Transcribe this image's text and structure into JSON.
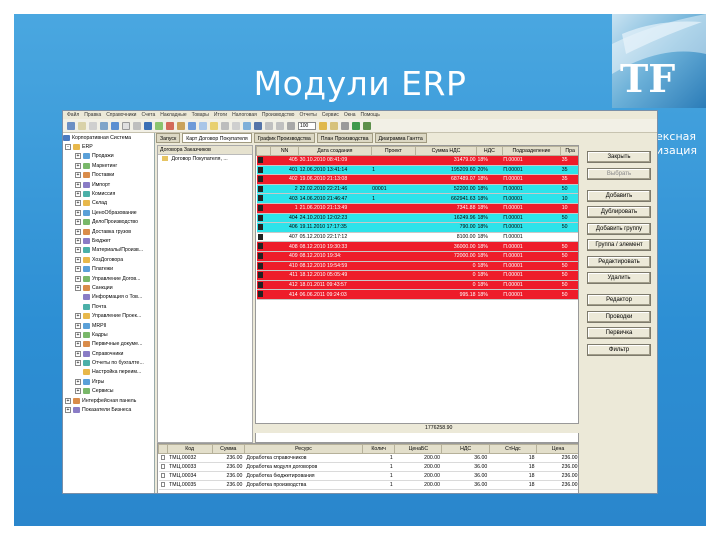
{
  "slide": {
    "title": "Модули ERP",
    "logo_text": "TF",
    "corner_caption_line1": "ексная",
    "corner_caption_line2": "изация"
  },
  "app": {
    "menu": [
      "Файл",
      "Правка",
      "Справочники",
      "Счета",
      "Накладные",
      "Товары",
      "Итоги",
      "Налоговая",
      "Производство",
      "Отчеты",
      "Сервис",
      "Окна",
      "Помощь"
    ],
    "zoom_value": "100",
    "sidebar": {
      "root": "Корпоративная Система",
      "items": [
        {
          "label": "ERP",
          "level": 0,
          "expand": "-"
        },
        {
          "label": "Продажи",
          "level": 1,
          "expand": "+"
        },
        {
          "label": "Маркетинг",
          "level": 1,
          "expand": "+"
        },
        {
          "label": "Поставки",
          "level": 1,
          "expand": "+"
        },
        {
          "label": "Импорт",
          "level": 1,
          "expand": "+"
        },
        {
          "label": "Комиссия",
          "level": 1,
          "expand": "+"
        },
        {
          "label": "Склад",
          "level": 1,
          "expand": "+"
        },
        {
          "label": "ЦеноОбразование",
          "level": 1,
          "expand": "+"
        },
        {
          "label": "ДелоПроизводство",
          "level": 1,
          "expand": "+"
        },
        {
          "label": "Доставка грузов",
          "level": 1,
          "expand": "+"
        },
        {
          "label": "Бюджет",
          "level": 1,
          "expand": "+"
        },
        {
          "label": "Материалы/Произв...",
          "level": 1,
          "expand": "+"
        },
        {
          "label": "ХозДоговора",
          "level": 1,
          "expand": "+"
        },
        {
          "label": "Платежи",
          "level": 1,
          "expand": "+"
        },
        {
          "label": "Управление Догов...",
          "level": 1,
          "expand": "+"
        },
        {
          "label": "Санкции",
          "level": 1,
          "expand": "+"
        },
        {
          "label": "Информация о Тов...",
          "level": 1,
          "expand": ""
        },
        {
          "label": "Почта",
          "level": 1,
          "expand": ""
        },
        {
          "label": "Управление Проек...",
          "level": 1,
          "expand": "+"
        },
        {
          "label": "MRPII",
          "level": 1,
          "expand": "+"
        },
        {
          "label": "Кадры",
          "level": 1,
          "expand": "+"
        },
        {
          "label": "Первичные докуме...",
          "level": 1,
          "expand": "+"
        },
        {
          "label": "Справочники",
          "level": 1,
          "expand": "+"
        },
        {
          "label": "Отчеты по бухгалте...",
          "level": 1,
          "expand": "+"
        },
        {
          "label": "Настройка переим...",
          "level": 1,
          "expand": ""
        },
        {
          "label": "Игры",
          "level": 1,
          "expand": "+"
        },
        {
          "label": "Сервисы",
          "level": 1,
          "expand": "+"
        },
        {
          "label": "Интерфейсная панель",
          "level": 0,
          "expand": "+"
        },
        {
          "label": "Показатели Бизнеса",
          "level": 0,
          "expand": "+"
        }
      ]
    },
    "tabs": [
      {
        "label": "Запуск",
        "active": false
      },
      {
        "label": "Карт Договор Покупателя",
        "active": true
      },
      {
        "label": "График Производства",
        "active": false
      },
      {
        "label": "План Производства",
        "active": false
      },
      {
        "label": "Диаграмма Гантта",
        "active": false
      }
    ],
    "subtree": {
      "header": "Договора Заказчиков",
      "row": "Договор Покупателя, ..."
    },
    "grid": {
      "columns": [
        "",
        "NN",
        "Дата создания",
        "Проект",
        "Сумма НДС",
        "НДС",
        "Подразделение",
        "Пра"
      ],
      "rows": [
        {
          "nn": "405",
          "date": "30.10.2010 08:41:09",
          "project": "",
          "sum": "31479.00",
          "vat": "18%",
          "dept": "П.00001",
          "pr": "35",
          "color": "red"
        },
        {
          "nn": "401",
          "date": "12.06.2010 13:41:14",
          "project": "1",
          "sum": "195209.60",
          "vat": "20%",
          "dept": "П.00001",
          "pr": "35",
          "color": "cyan"
        },
        {
          "nn": "402",
          "date": "19.06.2010 21:13:08",
          "project": "",
          "sum": "687489.07",
          "vat": "18%",
          "dept": "П.00001",
          "pr": "35",
          "color": "red"
        },
        {
          "nn": "2",
          "date": "22.02.2010 22:21:46",
          "project": "00001",
          "sum": "52200.00",
          "vat": "18%",
          "dept": "П.00001",
          "pr": "50",
          "color": "cyan"
        },
        {
          "nn": "403",
          "date": "14.06.2010 21:46:47",
          "project": "1",
          "sum": "662941.63",
          "vat": "18%",
          "dept": "П.00001",
          "pr": "10",
          "color": "cyan"
        },
        {
          "nn": "1",
          "date": "21.06.2010 21:13:49",
          "project": "",
          "sum": "7341.88",
          "vat": "18%",
          "dept": "П.00001",
          "pr": "10",
          "color": "red"
        },
        {
          "nn": "404",
          "date": "24.10.2010 12:02:23",
          "project": "",
          "sum": "16249.96",
          "vat": "18%",
          "dept": "П.00001",
          "pr": "50",
          "color": "cyan"
        },
        {
          "nn": "406",
          "date": "19.11.2010 17:17:35",
          "project": "",
          "sum": "790.00",
          "vat": "18%",
          "dept": "П.00001",
          "pr": "50",
          "color": "cyan"
        },
        {
          "nn": "407",
          "date": "05.12.2010 22:17:12",
          "project": "",
          "sum": "8100.00",
          "vat": "18%",
          "dept": "П.00001",
          "pr": "",
          "color": "white"
        },
        {
          "nn": "408",
          "date": "08.12.2010 19:30:33",
          "project": "",
          "sum": "36000.00",
          "vat": "18%",
          "dept": "П.00001",
          "pr": "50",
          "color": "red"
        },
        {
          "nn": "409",
          "date": "08.12.2010 19:34:",
          "project": "",
          "sum": "72000.00",
          "vat": "18%",
          "dept": "П.00001",
          "pr": "50",
          "color": "red"
        },
        {
          "nn": "410",
          "date": "08.12.2010 19:54:59",
          "project": "",
          "sum": "0",
          "vat": "18%",
          "dept": "П.00001",
          "pr": "50",
          "color": "red"
        },
        {
          "nn": "411",
          "date": "18.12.2010 05:05:49",
          "project": "",
          "sum": "0",
          "vat": "18%",
          "dept": "П.00001",
          "pr": "50",
          "color": "red"
        },
        {
          "nn": "412",
          "date": "18.01.2011 09:43:57",
          "project": "",
          "sum": "0",
          "vat": "18%",
          "dept": "П.00001",
          "pr": "50",
          "color": "red"
        },
        {
          "nn": "414",
          "date": "06.06.2011 09:24:03",
          "project": "",
          "sum": "995.18",
          "vat": "18%",
          "dept": "П.00001",
          "pr": "50",
          "color": "red"
        }
      ],
      "total": "1776258.90"
    },
    "actions": [
      {
        "label": "Закрыть",
        "enabled": true
      },
      {
        "label": "Выбрать",
        "enabled": false
      },
      {
        "label": "Добавить",
        "enabled": true
      },
      {
        "label": "Дублировать",
        "enabled": true
      },
      {
        "label": "Добавить группу",
        "enabled": true
      },
      {
        "label": "Группа / элемент",
        "enabled": true
      },
      {
        "label": "Редактировать",
        "enabled": true
      },
      {
        "label": "Удалить",
        "enabled": true
      },
      {
        "label": "Редактор",
        "enabled": true
      },
      {
        "label": "Проводки",
        "enabled": true
      },
      {
        "label": "Первичка",
        "enabled": true
      },
      {
        "label": "Фильтр",
        "enabled": true
      }
    ],
    "bottom": {
      "columns": [
        "",
        "Код",
        "Сумма",
        "Ресурс",
        "Колич",
        "ЦенаБС",
        "НДС",
        "СтНдс",
        "Цена"
      ],
      "rows": [
        {
          "code": "ТМЦ.00032",
          "sum": "236.00",
          "res": "Доработка справочников",
          "qty": "1",
          "price_bs": "200.00",
          "vat": "36.00",
          "vat_rate": "18",
          "price": "236.00"
        },
        {
          "code": "ТМЦ.00033",
          "sum": "236.00",
          "res": "Доработка модуля договоров",
          "qty": "1",
          "price_bs": "200.00",
          "vat": "36.00",
          "vat_rate": "18",
          "price": "236.00"
        },
        {
          "code": "ТМЦ.00034",
          "sum": "236.00",
          "res": "Доработка бюджетирования",
          "qty": "1",
          "price_bs": "200.00",
          "vat": "36.00",
          "vat_rate": "18",
          "price": "236.00"
        },
        {
          "code": "ТМЦ.00035",
          "sum": "236.00",
          "res": "Доработка производства",
          "qty": "1",
          "price_bs": "200.00",
          "vat": "36.00",
          "vat_rate": "18",
          "price": "236.00"
        }
      ]
    },
    "colors": {
      "row_red": "#ee1c2a",
      "row_cyan": "#2ee3ea",
      "slide_blue": "#2d8fd4"
    }
  }
}
